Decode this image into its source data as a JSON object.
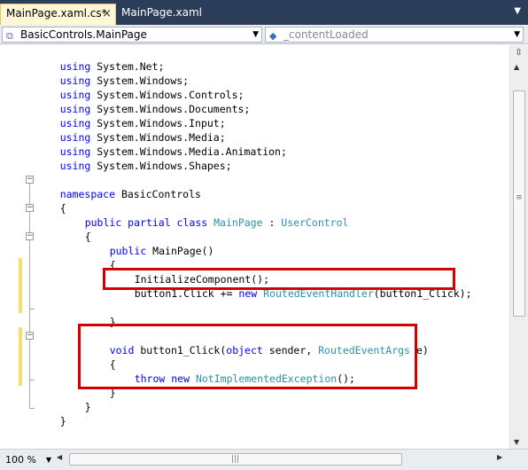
{
  "tabs": [
    {
      "label": "MainPage.xaml.cs*",
      "active": true
    },
    {
      "label": "MainPage.xaml",
      "active": false
    }
  ],
  "tab_close_glyph": "×",
  "tab_menu_glyph": "▼",
  "navbar": {
    "type_combo": "BasicControls.MainPage",
    "member_combo": "_contentLoaded",
    "type_icon": "class-icon",
    "member_icon": "field-icon"
  },
  "code_lines": [
    "using System.Net;",
    "using System.Windows;",
    "using System.Windows.Controls;",
    "using System.Windows.Documents;",
    "using System.Windows.Input;",
    "using System.Windows.Media;",
    "using System.Windows.Media.Animation;",
    "using System.Windows.Shapes;",
    "",
    "namespace BasicControls",
    "{",
    "    public partial class MainPage : UserControl",
    "    {",
    "        public MainPage()",
    "        {",
    "            InitializeComponent();",
    "            button1.Click += new RoutedEventHandler(button1_Click);",
    "",
    "        }",
    "",
    "        void button1_Click(object sender, RoutedEventArgs e)",
    "        {",
    "            throw new NotImplementedException();",
    "        }",
    "    }",
    "}"
  ],
  "zoom_level": "100 %",
  "colors": {
    "keyword": "#0000ff",
    "type": "#2b91af",
    "highlight_box": "#d40000",
    "change_marker": "#f5df6c",
    "active_tab": "#fff8d8"
  }
}
